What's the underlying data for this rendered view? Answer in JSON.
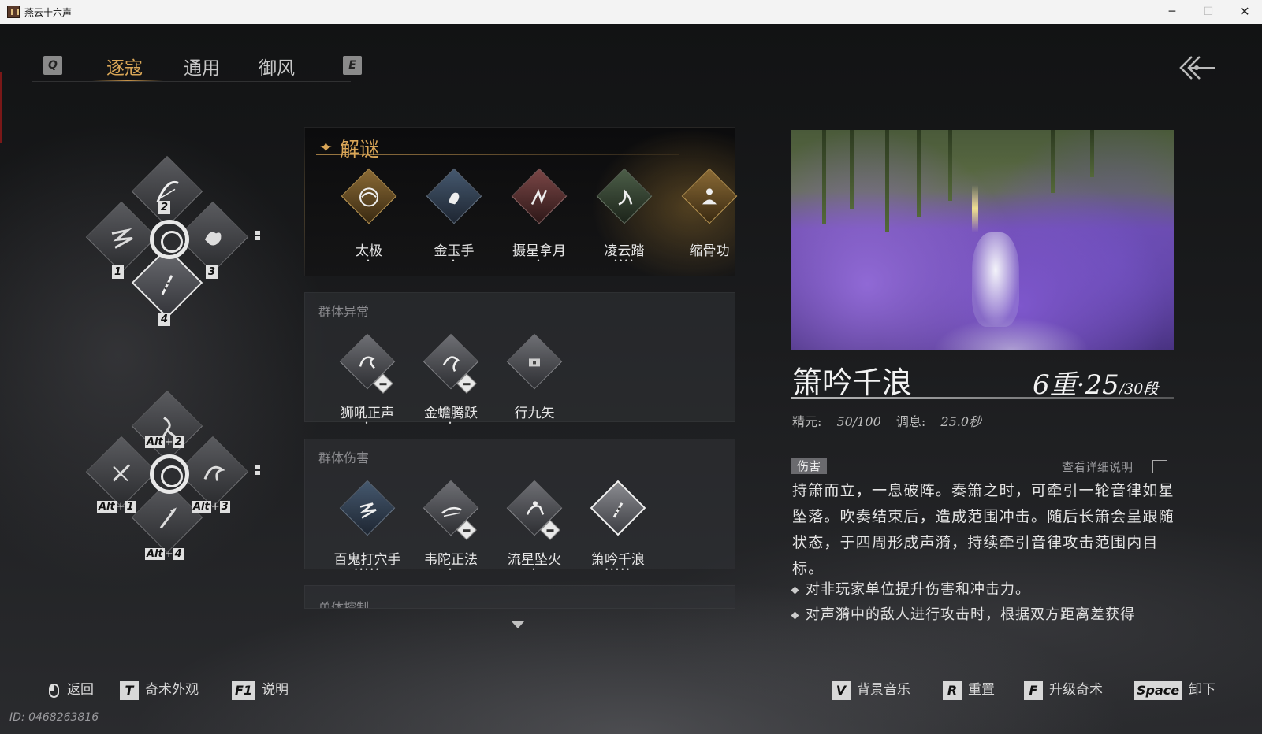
{
  "window": {
    "title": "燕云十六声",
    "minimize": "─",
    "maximize": "☐",
    "close": "✕"
  },
  "tabs": {
    "prev_key": "Q",
    "next_key": "E",
    "items": [
      {
        "label": "逐寇",
        "active": true
      },
      {
        "label": "通用",
        "active": false
      },
      {
        "label": "御风",
        "active": false
      }
    ]
  },
  "wheels": {
    "primary": {
      "slots": [
        "1",
        "2",
        "3",
        "4"
      ]
    },
    "alt": {
      "modifier": "Alt",
      "plus": "+",
      "slots": [
        "1",
        "2",
        "3",
        "4"
      ]
    }
  },
  "featured": {
    "title": "解谜",
    "skills": [
      {
        "name": "太极",
        "dots": "•",
        "tone": "gold"
      },
      {
        "name": "金玉手",
        "dots": "•",
        "tone": "blue"
      },
      {
        "name": "摄星拿月",
        "dots": "•",
        "tone": "red"
      },
      {
        "name": "凌云踏",
        "dots": "••••",
        "tone": "green"
      },
      {
        "name": "缩骨功",
        "dots": "",
        "tone": "gold"
      }
    ]
  },
  "groups": [
    {
      "title": "群体异常",
      "skills": [
        {
          "name": "狮吼正声",
          "dots": "•",
          "badge": true
        },
        {
          "name": "金蟾腾跃",
          "dots": "•",
          "badge": true
        },
        {
          "name": "行九矢",
          "dots": "",
          "badge": false
        }
      ]
    },
    {
      "title": "群体伤害",
      "skills": [
        {
          "name": "百鬼打穴手",
          "dots": "•••••",
          "badge": false,
          "crest": true
        },
        {
          "name": "韦陀正法",
          "dots": "•",
          "badge": true
        },
        {
          "name": "流星坠火",
          "dots": "•",
          "badge": true
        },
        {
          "name": "箫吟千浪",
          "dots": "•••••",
          "badge": false,
          "selected": true
        }
      ]
    },
    {
      "title": "单体控制",
      "skills": []
    }
  ],
  "detail": {
    "name": "箫吟千浪",
    "level": "6重·25",
    "segments": "/30段",
    "stats": {
      "jingyuan_label": "精元:",
      "jingyuan_value": "50/100",
      "tiaoxi_label": "调息:",
      "tiaoxi_value": "25.0秒"
    },
    "tag": "伤害",
    "more_link": "查看详细说明",
    "description": "持箫而立，一息破阵。奏箫之时，可牵引一轮音律如星坠落。吹奏结束后，造成范围冲击。随后长箫会呈跟随状态，于四周形成声漪，持续牵引音律攻击范围内目标。",
    "bullets": [
      "对非玩家单位提升伤害和冲击力。",
      "对声漪中的敌人进行攻击时，根据双方距离差获得"
    ]
  },
  "footer": {
    "left": [
      {
        "key": "mouse",
        "label": "返回"
      },
      {
        "key": "T",
        "label": "奇术外观"
      },
      {
        "key": "F1",
        "label": "说明"
      }
    ],
    "right": [
      {
        "key": "V",
        "label": "背景音乐"
      },
      {
        "key": "R",
        "label": "重置"
      },
      {
        "key": "F",
        "label": "升级奇术"
      },
      {
        "key": "Space",
        "label": "卸下"
      }
    ],
    "uid": "ID: 0468263816"
  },
  "colors": {
    "accent": "#d9a657",
    "text": "#e4e4e4",
    "muted": "#8a8a8e"
  }
}
